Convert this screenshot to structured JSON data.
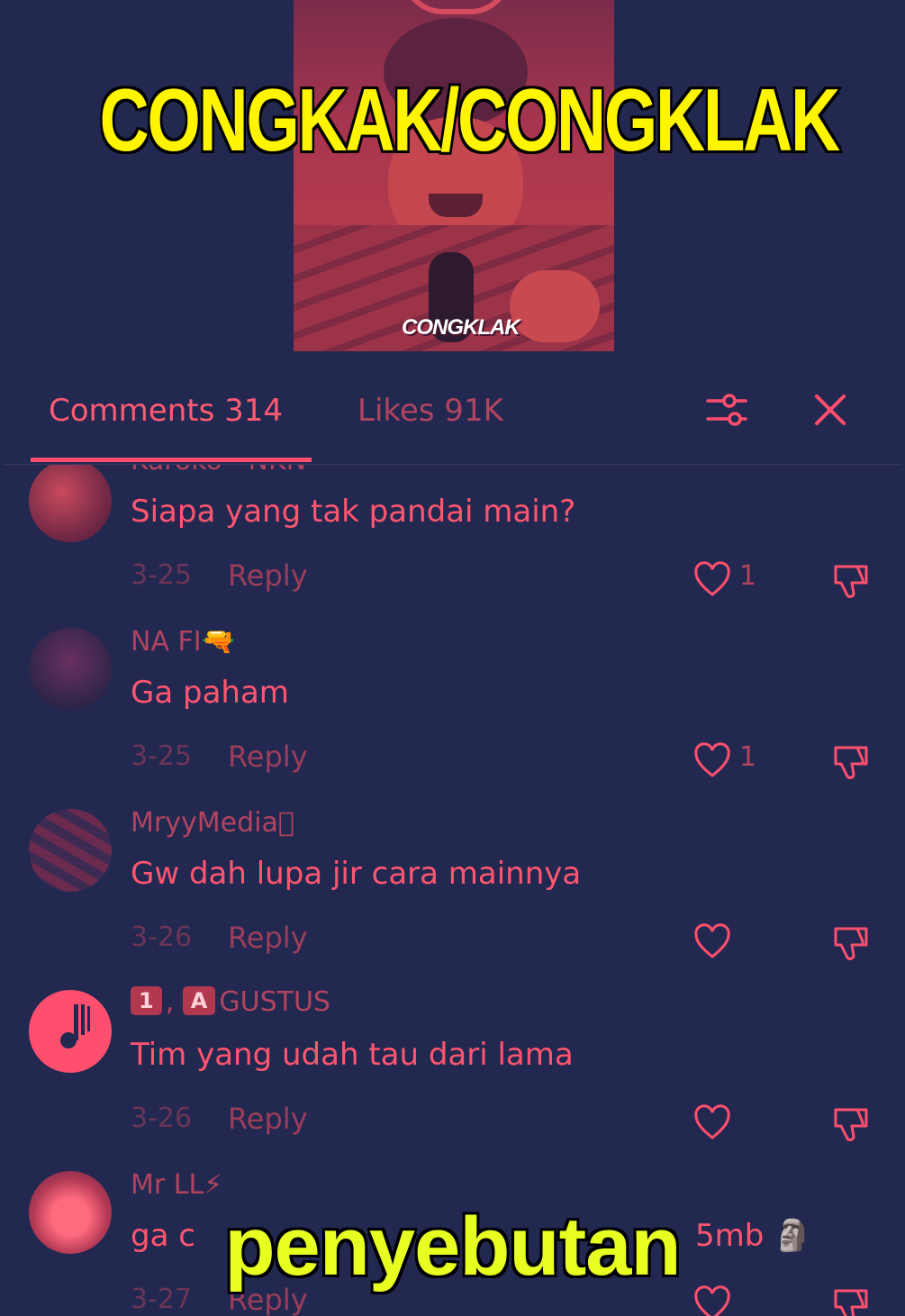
{
  "overlay": {
    "title": "CONGKAK/CONGKLAK",
    "subtitle": "penyebutan"
  },
  "video": {
    "caption": "CONGKLAK"
  },
  "tabs": {
    "comments_label": "Comments 314",
    "likes_label": "Likes 91K"
  },
  "icons": {
    "filter": "filter-sliders-icon",
    "close": "close-icon",
    "like": "heart-icon",
    "dislike": "thumbs-down-icon"
  },
  "colors": {
    "background": "#232850",
    "accent": "#ff4f6e",
    "title_yellow": "#fff500",
    "subtitle_yellow": "#e8ff22"
  },
  "comments": [
    {
      "username": "Kuroko · NKN",
      "text": "Siapa yang tak pandai main?",
      "date": "3-25",
      "reply_label": "Reply",
      "likes": "1"
    },
    {
      "username": "NA FI🔫",
      "text": "Ga paham",
      "date": "3-25",
      "reply_label": "Reply",
      "likes": "1"
    },
    {
      "username": "MryyMedia",
      "text": "Gw dah lupa jir cara mainnya",
      "date": "3-26",
      "reply_label": "Reply",
      "likes": ""
    },
    {
      "username_badge_1": "1",
      "username_sep": ",",
      "username_badge_2": "A",
      "username": "GUSTUS",
      "text": "Tim yang udah tau dari lama",
      "date": "3-26",
      "reply_label": "Reply",
      "likes": ""
    },
    {
      "username": "Mr LL⚡",
      "text_start": "ga c",
      "text_end": "5mb 🗿",
      "date": "3-27",
      "reply_label": "Reply",
      "likes": ""
    }
  ]
}
